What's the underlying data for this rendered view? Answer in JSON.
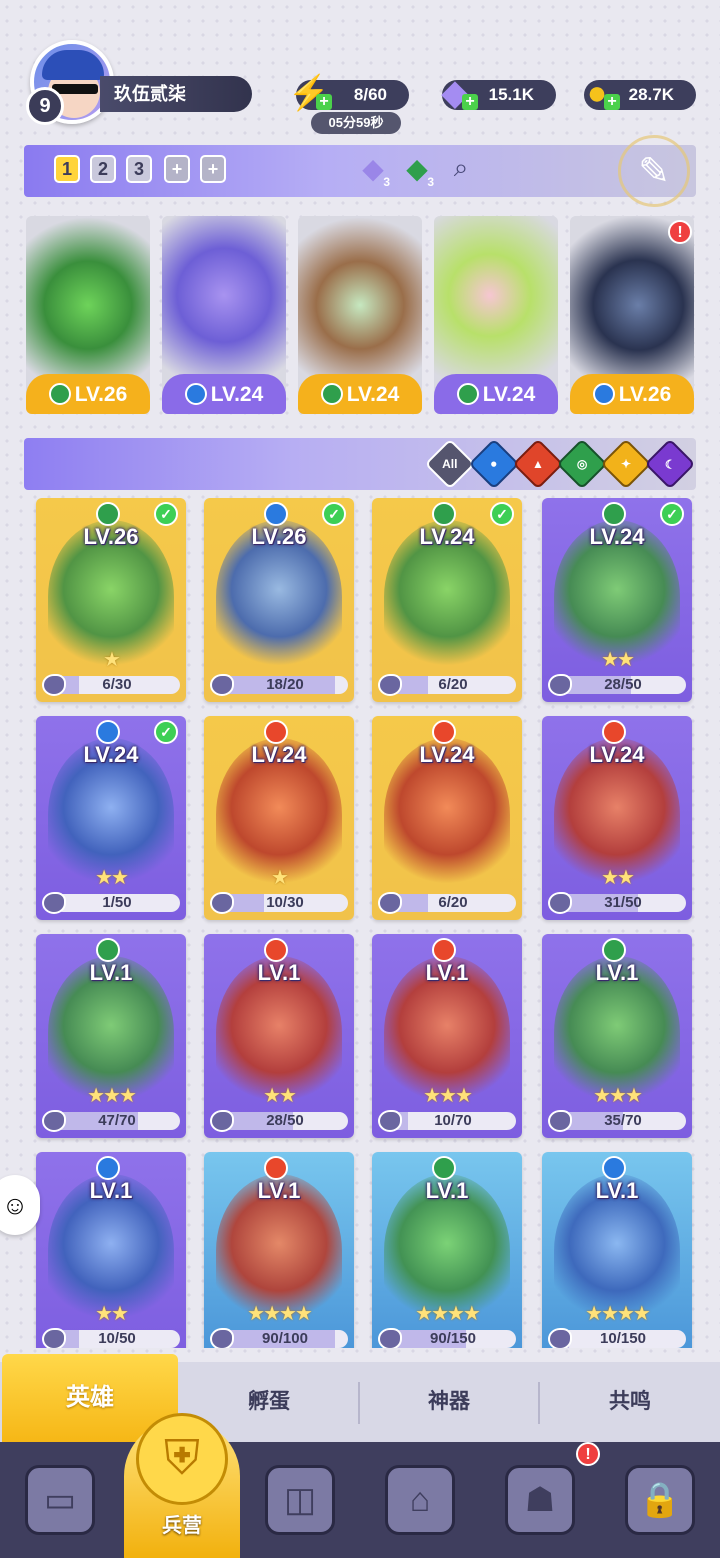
{
  "player": {
    "level": "9",
    "name": "玖伍贰柒"
  },
  "resources": {
    "energy": "8/60",
    "energy_timer": "05分59秒",
    "gems": "15.1K",
    "coins": "28.7K",
    "energy_icon": "lightning-icon",
    "gems_icon": "diamond-icon",
    "coins_icon": "coin-icon"
  },
  "team": {
    "tabs": [
      "1",
      "2",
      "3",
      "+",
      "+"
    ],
    "active_tab": "1",
    "slot_counts": [
      "3",
      "3"
    ]
  },
  "lineup": [
    {
      "level": "LV.26",
      "element": "wind",
      "frame": "gold",
      "stars": "★"
    },
    {
      "level": "LV.24",
      "element": "water",
      "frame": "purple",
      "stars": "★★"
    },
    {
      "level": "LV.24",
      "element": "wind",
      "frame": "gold",
      "stars": ""
    },
    {
      "level": "LV.24",
      "element": "wind",
      "frame": "purple",
      "stars": "★★"
    },
    {
      "level": "LV.26",
      "element": "water",
      "frame": "gold",
      "stars": ""
    }
  ],
  "filters": {
    "all_label": "All",
    "items": [
      "all",
      "water",
      "fire",
      "wind",
      "light",
      "dark"
    ]
  },
  "heroes": [
    {
      "level": "LV.26",
      "element": "wind",
      "frame": "gold",
      "progress": "6/30",
      "fraction": 0.2,
      "stars": "★",
      "checked": true
    },
    {
      "level": "LV.26",
      "element": "water",
      "frame": "gold",
      "progress": "18/20",
      "fraction": 0.9,
      "stars": "",
      "checked": true
    },
    {
      "level": "LV.24",
      "element": "wind",
      "frame": "gold",
      "progress": "6/20",
      "fraction": 0.3,
      "stars": "",
      "checked": true
    },
    {
      "level": "LV.24",
      "element": "wind",
      "frame": "purple",
      "progress": "28/50",
      "fraction": 0.56,
      "stars": "★★",
      "checked": true
    },
    {
      "level": "LV.24",
      "element": "water",
      "frame": "purple",
      "progress": "1/50",
      "fraction": 0.02,
      "stars": "★★",
      "checked": true
    },
    {
      "level": "LV.24",
      "element": "fire",
      "frame": "gold",
      "progress": "10/30",
      "fraction": 0.33,
      "stars": "★",
      "checked": false
    },
    {
      "level": "LV.24",
      "element": "fire",
      "frame": "gold",
      "progress": "6/20",
      "fraction": 0.3,
      "stars": "",
      "checked": false
    },
    {
      "level": "LV.24",
      "element": "fire",
      "frame": "purple",
      "progress": "31/50",
      "fraction": 0.62,
      "stars": "★★",
      "checked": false
    },
    {
      "level": "LV.1",
      "element": "wind",
      "frame": "purple",
      "progress": "47/70",
      "fraction": 0.67,
      "stars": "★★★",
      "checked": false
    },
    {
      "level": "LV.1",
      "element": "fire",
      "frame": "purple",
      "progress": "28/50",
      "fraction": 0.56,
      "stars": "★★",
      "checked": false
    },
    {
      "level": "LV.1",
      "element": "fire",
      "frame": "purple",
      "progress": "10/70",
      "fraction": 0.14,
      "stars": "★★★",
      "checked": false
    },
    {
      "level": "LV.1",
      "element": "wind",
      "frame": "purple",
      "progress": "35/70",
      "fraction": 0.5,
      "stars": "★★★",
      "checked": false
    },
    {
      "level": "LV.1",
      "element": "water",
      "frame": "purple",
      "progress": "10/50",
      "fraction": 0.2,
      "stars": "★★",
      "checked": false
    },
    {
      "level": "LV.1",
      "element": "fire",
      "frame": "blue",
      "progress": "90/100",
      "fraction": 0.9,
      "stars": "★★★★",
      "checked": false
    },
    {
      "level": "LV.1",
      "element": "wind",
      "frame": "blue",
      "progress": "90/150",
      "fraction": 0.6,
      "stars": "★★★★",
      "checked": false
    },
    {
      "level": "LV.1",
      "element": "water",
      "frame": "blue",
      "progress": "10/150",
      "fraction": 0.07,
      "stars": "★★★★",
      "checked": false
    }
  ],
  "subtabs": [
    "英雄",
    "孵蛋",
    "神器",
    "共鸣"
  ],
  "active_subtab": "英雄",
  "bottom_nav": {
    "active_label": "兵营",
    "icons": [
      "cards-icon",
      "barracks-icon",
      "map-icon",
      "temple-icon",
      "mushroom-house-icon",
      "locked-banner-icon"
    ]
  },
  "colors": {
    "gold_frame": "#f5c94a",
    "purple_frame": "#8f72ea",
    "blue_frame": "#78c6ee",
    "nav_bg": "#3f3e5e",
    "active_tab": "#ffd84a",
    "alert": "#ef3f3f",
    "check": "#3dcf55"
  }
}
